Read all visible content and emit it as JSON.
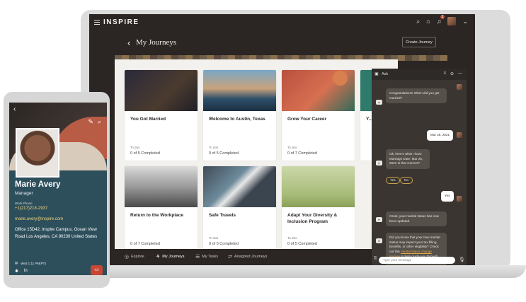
{
  "app": {
    "brand": "INSPIRE"
  },
  "header": {
    "page_title": "My Journeys",
    "create_label": "Create Journey",
    "notification_count": "2"
  },
  "cards": [
    {
      "title": "You Got Married",
      "todo_label": "To dos",
      "status": "0 of 5 Completed"
    },
    {
      "title": "Welcome to Austin, Texas",
      "todo_label": "To dos",
      "status": "0 of 5 Completed"
    },
    {
      "title": "Grow Your Career",
      "todo_label": "To dos",
      "status": "0 of 7 Completed"
    },
    {
      "title": "Y...",
      "todo_label": "",
      "status": ""
    },
    {
      "title": "Return to the Workplace",
      "todo_label": "",
      "status": "0 of 7 Completed"
    },
    {
      "title": "Safe Travels",
      "todo_label": "To dos",
      "status": "0 of 5 Completed"
    },
    {
      "title": "Adapt Your Diversity & Inclusion Program",
      "todo_label": "To dos",
      "status": "0 of 5 Completed"
    }
  ],
  "bottom_nav": [
    "Explore",
    "My Journeys",
    "My Tasks",
    "Assigned Journeys"
  ],
  "chat": {
    "title": "Ask",
    "msg1": "Congratulations! When did you get married?",
    "reply1": "Mar 25, 2021",
    "msg2": "Ok, here's what I have Marriage Date: Mar 25, 2021 Is that Correct?",
    "yes": "Yes",
    "no": "No",
    "reply2": "Yes",
    "msg3": "Great, your marital status has now been updated.",
    "msg4_a": "Did you know that your new marital status may impact your tax filling, benefits, or other eligibility? Check out this",
    "msg4_link": "marital status change journey",
    "msg4_b": "to help guide you through this process.",
    "input_placeholder": "Type your message"
  },
  "phone": {
    "name": "Marie Avery",
    "role": "Manager",
    "work_phone_label": "Work Phone",
    "work_phone": "+1(217)218-2937",
    "email": "marie.avery@inspire.com",
    "address": "Office 15D42, Inspire Campus, Ocean View Road Los Angeles, CA 90230 United States",
    "time": "Wed 1:11 PM(PT)"
  }
}
